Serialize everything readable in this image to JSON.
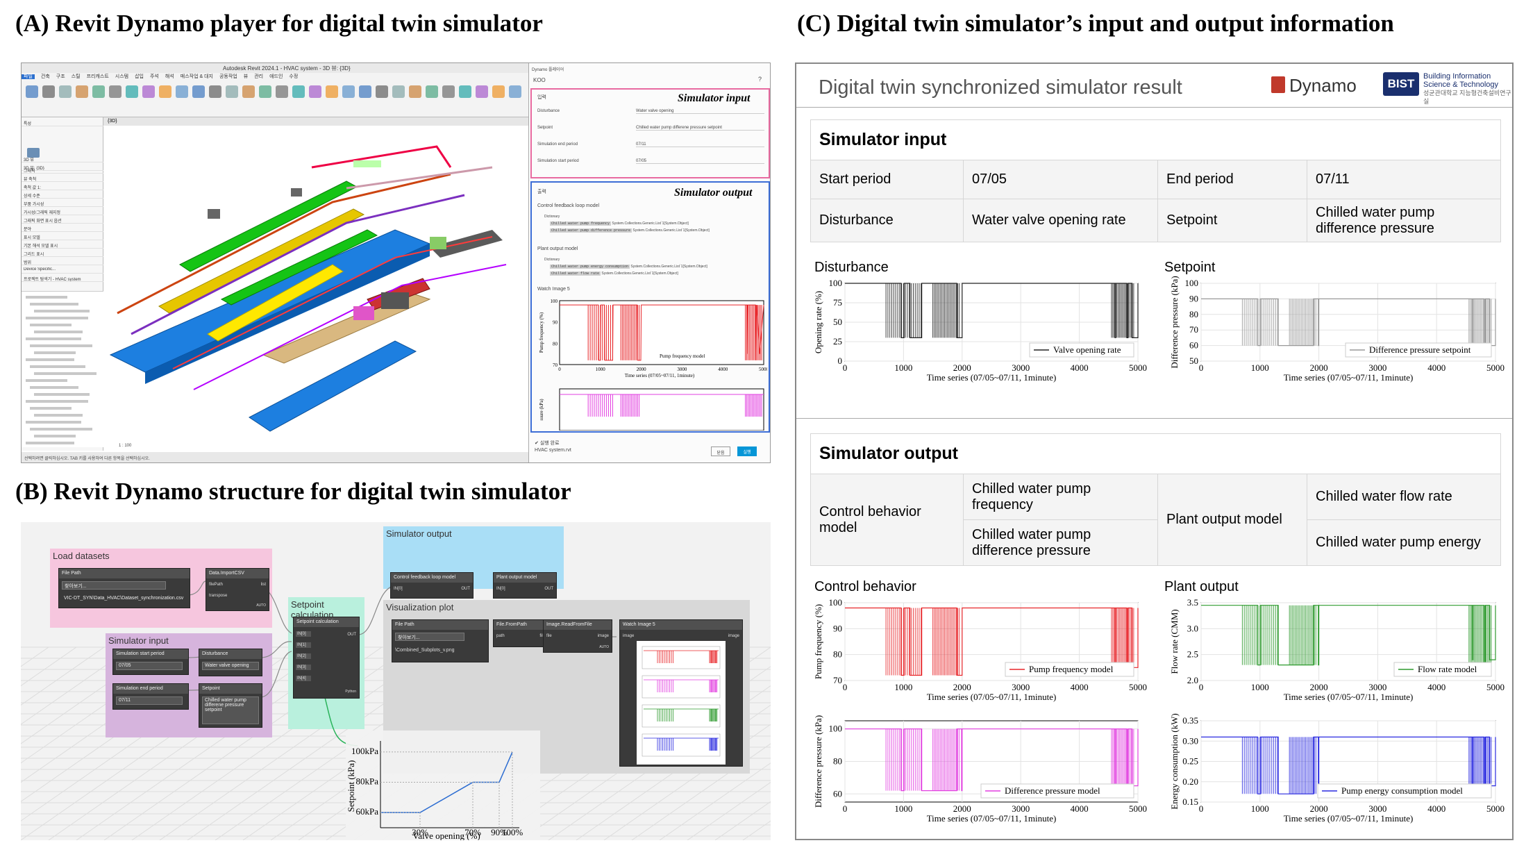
{
  "sections": {
    "a": "(A) Revit Dynamo player for digital twin simulator",
    "b": "(B) Revit Dynamo structure for digital twin simulator",
    "c": "(C) Digital twin simulator’s input and output information"
  },
  "revit": {
    "window_title": "Autodesk Revit 2024.1 - HVAC system - 3D 뷰: {3D}",
    "ribbon_tabs": [
      "파일",
      "건축",
      "구조",
      "스틸",
      "프리캐스트",
      "시스템",
      "삽입",
      "주석",
      "해석",
      "매스작업 & 대지",
      "공동작업",
      "뷰",
      "관리",
      "애드인",
      "수정"
    ],
    "view_tab": "{3D}",
    "scale": "1 : 100",
    "properties": [
      "특성",
      "3D 뷰",
      "3D 뷰: {3D}",
      "그래픽",
      "뷰 축척",
      "축척 값 1:",
      "상세 수준",
      "부품 가시성",
      "가시성/그래픽 재지정",
      "그래픽 화면 표시 옵션",
      "분야",
      "표시 모델",
      "기본 해석 모델 표시",
      "그리드 표시",
      "범위",
      "Device Specific...",
      "프로젝트 탐색기 - HVAC system"
    ],
    "status": "선택하려면 클릭하십시오. TAB 키를 사용하여 다른 항목을 선택하십시오."
  },
  "player": {
    "app_title": "Dynamo 플레이어",
    "script_name": "KOO",
    "tag_input": "Simulator input",
    "tag_output": "Simulator output",
    "inputs_header": "입력",
    "inputs": [
      {
        "label": "Disturbance",
        "value": "Water valve opening"
      },
      {
        "label": "Setpoint",
        "value": "Chilled water pump differene pressure setpoint"
      },
      {
        "label": "Simulation end period",
        "value": "07/11"
      },
      {
        "label": "Simulation start period",
        "value": "07/05"
      }
    ],
    "outputs_header": "출력",
    "control_model": "Control feedback loop model",
    "plant_model": "Plant output model",
    "dictionary": "Dictionary",
    "ctrl_keys": [
      "Chilled water pump frequency",
      "Chilled water pump difference pressure"
    ],
    "plant_keys": [
      "Chilled water pump energy consumption",
      "Chilled water flow rate"
    ],
    "list_type": "System.Collections.Generic.List`1[System.Object]",
    "watch_label": "Watch Image 5",
    "mini_legend": "Pump frequency model",
    "mini_xlabel": "Time series (07/05~07/11, 1minute)",
    "mini_ylabel": "Pump frequency (%)",
    "mini_y2label": "ssure (kPa)",
    "status_ok": "실행 완료",
    "file": "HVAC system.rvt",
    "btn_close": "닫음",
    "btn_run": "실행"
  },
  "dynamo": {
    "groups": {
      "load": "Load datasets",
      "sim_input": "Simulator input",
      "setpoint": "Setpoint\ncalculation",
      "sim_output": "Simulator output",
      "vis": "Visualization plot"
    },
    "nodes": {
      "file_path": "File Path",
      "browse": "찾아보기...",
      "csv_path": "VIC-DT_SYN\\Data_HVAC\\Dataset_synchronization.csv",
      "import_csv": "Data.ImportCSV",
      "file_path_port": "filePath",
      "transpose_port": "transpose",
      "auto": "AUTO",
      "list": "list",
      "start_period": "Simulation start period",
      "start_val": "07/05",
      "end_period": "Simulation end period",
      "end_val": "07/11",
      "disturbance": "Disturbance",
      "disturbance_val": "Water valve opening",
      "setpoint": "Setpoint",
      "setpoint_val": "Chilled water pump differene pressure setpoint",
      "setpoint_calc": "Setpoint calculation",
      "in_ports": [
        "IN[0]",
        "IN[1]",
        "IN[2]",
        "IN[3]",
        "IN[4]"
      ],
      "out": "OUT",
      "python": "Python",
      "ctrl_model": "Control feedback loop model",
      "plant_model": "Plant output model",
      "vis_file": "File Path",
      "png_path": "\\Combined_Subplots_v.png",
      "file_from_path": "File.FromPath",
      "path_port": "path",
      "file_port": "file",
      "read_image": "Image.ReadFromFile",
      "image_port": "image",
      "watch_image": "Watch Image 5"
    },
    "setpoint_graph": {
      "ylabel": "Setpoint (kPa)",
      "xlabel": "Valve opening (%)",
      "yticks": [
        "100kPa",
        "80kPa",
        "60kPa"
      ],
      "xticks": [
        "30%",
        "70%",
        "90%",
        "100%"
      ],
      "points": [
        [
          0,
          60
        ],
        [
          30,
          60
        ],
        [
          70,
          80
        ],
        [
          90,
          80
        ],
        [
          100,
          100
        ]
      ]
    }
  },
  "report": {
    "title": "Digital twin synchronized simulator result",
    "dynamo_logo": "Dynamo",
    "bist_logo": "BIST",
    "bist_line1": "Building Information",
    "bist_line2": "Science & Technology",
    "bist_line3": "성균관대학교 지능형건축설비연구실",
    "input_header": "Simulator input",
    "start_label": "Start period",
    "start_value": "07/05",
    "end_label": "End period",
    "end_value": "07/11",
    "dist_label": "Disturbance",
    "dist_value": "Water valve opening rate",
    "setp_label": "Setpoint",
    "setp_value": "Chilled water pump difference pressure",
    "plot_disturbance": "Disturbance",
    "plot_setpoint": "Setpoint",
    "output_header": "Simulator output",
    "ctrl_label": "Control behavior model",
    "ctrl_out1": "Chilled water pump frequency",
    "ctrl_out2": "Chilled water pump difference pressure",
    "plant_label": "Plant output model",
    "plant_out1": "Chilled water flow rate",
    "plant_out2": "Chilled water pump energy",
    "plot_control": "Control behavior",
    "plot_plant": "Plant output"
  },
  "chart_data": [
    {
      "type": "line",
      "title": "",
      "xlabel": "Time series (07/05~07/11, 1minute)",
      "ylabel": "Opening rate (%)",
      "xlim": [
        0,
        5000
      ],
      "ylim": [
        0,
        100
      ],
      "xticks": [
        0,
        1000,
        2000,
        3000,
        4000,
        5000
      ],
      "yticks": [
        0,
        25,
        50,
        75,
        100
      ],
      "series": [
        {
          "name": "Valve opening rate",
          "color": "#222222",
          "values": [
            [
              0,
              100
            ],
            [
              950,
              100
            ],
            [
              960,
              30
            ],
            [
              1000,
              30
            ],
            [
              1010,
              100
            ],
            [
              1100,
              100
            ],
            [
              1110,
              30
            ],
            [
              1300,
              30
            ],
            [
              1310,
              100
            ],
            [
              1900,
              100
            ],
            [
              1910,
              30
            ],
            [
              1990,
              30
            ],
            [
              2000,
              100
            ],
            [
              4600,
              100
            ],
            [
              4610,
              30
            ],
            [
              4620,
              100
            ],
            [
              4800,
              100
            ],
            [
              4810,
              30
            ],
            [
              4830,
              100
            ],
            [
              4900,
              30
            ],
            [
              5000,
              100
            ]
          ]
        }
      ],
      "legend": "bottom-right",
      "grid": true
    },
    {
      "type": "line",
      "title": "",
      "xlabel": "Time series (07/05~07/11, 1minute)",
      "ylabel": "Difference pressure (kPa)",
      "xlim": [
        0,
        5000
      ],
      "ylim": [
        50,
        100
      ],
      "xticks": [
        0,
        1000,
        2000,
        3000,
        4000,
        5000
      ],
      "yticks": [
        50,
        60,
        70,
        80,
        90,
        100
      ],
      "series": [
        {
          "name": "Difference pressure setpoint",
          "color": "#999999",
          "values": [
            [
              0,
              90
            ],
            [
              950,
              90
            ],
            [
              960,
              60
            ],
            [
              1000,
              60
            ],
            [
              1010,
              90
            ],
            [
              1300,
              90
            ],
            [
              1310,
              60
            ],
            [
              1900,
              60
            ],
            [
              1910,
              90
            ],
            [
              1990,
              60
            ],
            [
              2000,
              90
            ],
            [
              4600,
              90
            ],
            [
              4610,
              60
            ],
            [
              4620,
              90
            ],
            [
              4800,
              90
            ],
            [
              4810,
              60
            ],
            [
              4830,
              90
            ],
            [
              4900,
              60
            ],
            [
              5000,
              90
            ]
          ]
        }
      ],
      "legend": "bottom-right",
      "grid": true
    },
    {
      "type": "line",
      "title": "",
      "xlabel": "Time series (07/05~07/11, 1minute)",
      "ylabel": "Pump frequency (%)",
      "xlim": [
        0,
        5000
      ],
      "ylim": [
        70,
        100
      ],
      "xticks": [
        0,
        1000,
        2000,
        3000,
        4000,
        5000
      ],
      "yticks": [
        70,
        80,
        90,
        100
      ],
      "series": [
        {
          "name": "Pump frequency model",
          "color": "#e8262a",
          "values": [
            [
              0,
              98
            ],
            [
              950,
              98
            ],
            [
              960,
              72
            ],
            [
              1000,
              72
            ],
            [
              1010,
              98
            ],
            [
              1100,
              98
            ],
            [
              1110,
              72
            ],
            [
              1300,
              72
            ],
            [
              1310,
              98
            ],
            [
              1900,
              98
            ],
            [
              1910,
              72
            ],
            [
              1990,
              72
            ],
            [
              2000,
              98
            ],
            [
              4600,
              98
            ],
            [
              4610,
              75
            ],
            [
              4620,
              98
            ],
            [
              4800,
              98
            ],
            [
              4810,
              72
            ],
            [
              4830,
              98
            ],
            [
              4900,
              75
            ],
            [
              5000,
              98
            ]
          ]
        }
      ],
      "legend": "bottom-right",
      "grid": true
    },
    {
      "type": "line",
      "title": "",
      "xlabel": "Time series (07/05~07/11, 1minute)",
      "ylabel": "Flow rate (CMM)",
      "xlim": [
        0,
        5000
      ],
      "ylim": [
        2,
        3.5
      ],
      "xticks": [
        0,
        1000,
        2000,
        3000,
        4000,
        5000
      ],
      "yticks": [
        2.0,
        2.5,
        3.0,
        3.5
      ],
      "series": [
        {
          "name": "Flow rate model",
          "color": "#2e9a2e",
          "values": [
            [
              0,
              3.45
            ],
            [
              950,
              3.45
            ],
            [
              960,
              2.3
            ],
            [
              1000,
              2.3
            ],
            [
              1010,
              3.45
            ],
            [
              1300,
              3.45
            ],
            [
              1310,
              2.3
            ],
            [
              1900,
              2.3
            ],
            [
              1910,
              3.45
            ],
            [
              1990,
              2.3
            ],
            [
              2000,
              3.45
            ],
            [
              4600,
              3.45
            ],
            [
              4610,
              2.4
            ],
            [
              4620,
              3.45
            ],
            [
              4800,
              3.45
            ],
            [
              4810,
              2.3
            ],
            [
              4830,
              3.45
            ],
            [
              4900,
              2.4
            ],
            [
              5000,
              3.45
            ]
          ]
        }
      ],
      "legend": "bottom-right",
      "grid": true
    },
    {
      "type": "line",
      "title": "",
      "xlabel": "Time series (07/05~07/11, 1minute)",
      "ylabel": "Difference pressure (kPa)",
      "xlim": [
        0,
        5000
      ],
      "ylim": [
        55,
        105
      ],
      "xticks": [
        0,
        1000,
        2000,
        3000,
        4000,
        5000
      ],
      "yticks": [
        60,
        80,
        100
      ],
      "series": [
        {
          "name": "Difference pressure model",
          "color": "#e23fe0",
          "values": [
            [
              0,
              100
            ],
            [
              950,
              100
            ],
            [
              960,
              62
            ],
            [
              1000,
              62
            ],
            [
              1010,
              100
            ],
            [
              1300,
              100
            ],
            [
              1310,
              62
            ],
            [
              1900,
              62
            ],
            [
              1910,
              100
            ],
            [
              1990,
              62
            ],
            [
              2000,
              100
            ],
            [
              4600,
              100
            ],
            [
              4610,
              65
            ],
            [
              4620,
              100
            ],
            [
              4800,
              100
            ],
            [
              4810,
              62
            ],
            [
              4830,
              100
            ],
            [
              4900,
              65
            ],
            [
              5000,
              100
            ]
          ]
        }
      ],
      "legend": "bottom-right",
      "grid": true
    },
    {
      "type": "line",
      "title": "",
      "xlabel": "Time series (07/05~07/11, 1minute)",
      "ylabel": "Energy consumption (kW)",
      "xlim": [
        0,
        5000
      ],
      "ylim": [
        0.15,
        0.35
      ],
      "xticks": [
        0,
        1000,
        2000,
        3000,
        4000,
        5000
      ],
      "yticks": [
        0.15,
        0.2,
        0.25,
        0.3,
        0.35
      ],
      "series": [
        {
          "name": "Pump energy consumption model",
          "color": "#2a2ae0",
          "values": [
            [
              0,
              0.31
            ],
            [
              950,
              0.31
            ],
            [
              960,
              0.17
            ],
            [
              1000,
              0.17
            ],
            [
              1010,
              0.31
            ],
            [
              1300,
              0.31
            ],
            [
              1310,
              0.17
            ],
            [
              1900,
              0.17
            ],
            [
              1910,
              0.31
            ],
            [
              1990,
              0.17
            ],
            [
              2000,
              0.31
            ],
            [
              4600,
              0.31
            ],
            [
              4610,
              0.19
            ],
            [
              4620,
              0.31
            ],
            [
              4800,
              0.31
            ],
            [
              4810,
              0.17
            ],
            [
              4830,
              0.31
            ],
            [
              4900,
              0.19
            ],
            [
              5000,
              0.31
            ]
          ]
        }
      ],
      "legend": "bottom-right",
      "grid": true
    }
  ]
}
